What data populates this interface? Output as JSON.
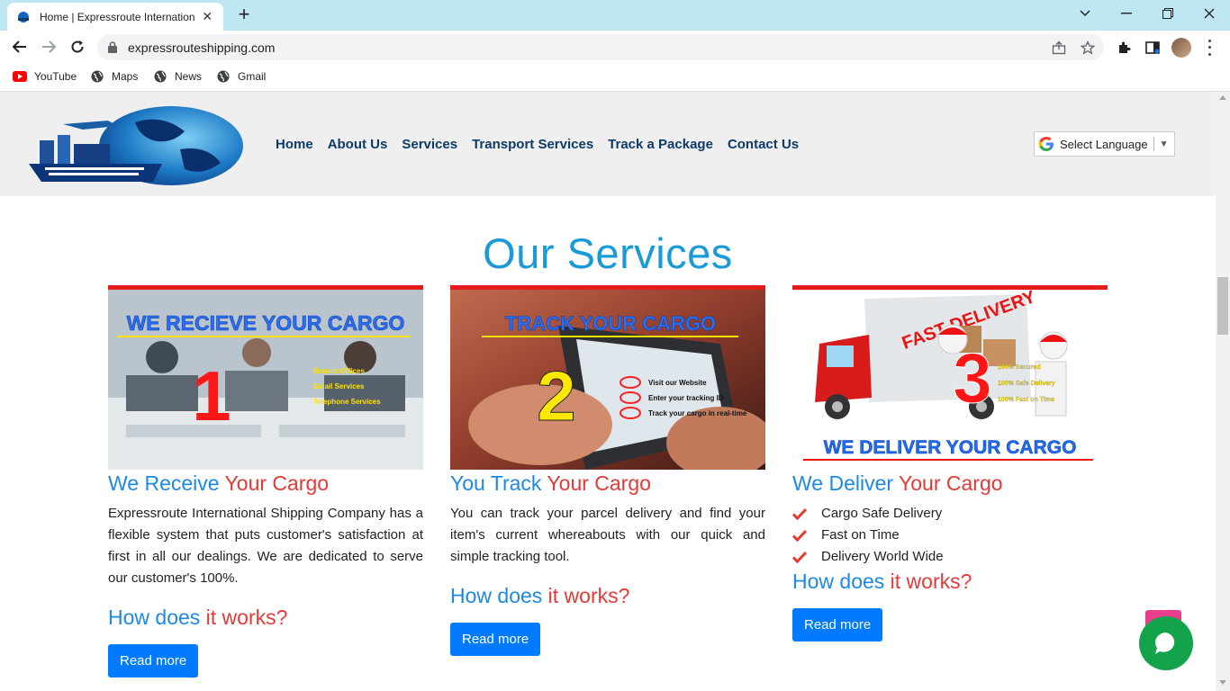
{
  "browser": {
    "tab_title": "Home | Expressroute International",
    "url": "expressrouteshipping.com",
    "bookmarks": [
      {
        "label": "YouTube",
        "icon": "youtube-icon"
      },
      {
        "label": "Maps",
        "icon": "globe-icon"
      },
      {
        "label": "News",
        "icon": "globe-icon"
      },
      {
        "label": "Gmail",
        "icon": "globe-icon"
      }
    ]
  },
  "site": {
    "nav": [
      "Home",
      "About Us",
      "Services",
      "Transport Services",
      "Track a Package",
      "Contact Us"
    ],
    "language_label": "Select Language",
    "section_title": "Our Services",
    "cards": [
      {
        "image_caption": "WE RECIEVE YOUR CARGO",
        "image_number": "1",
        "image_bullets": [
          "Branch Offices",
          "Email Services",
          "Telephone Services"
        ],
        "heading_plain": "We Receive ",
        "heading_accent": "Your Cargo",
        "body": "Expressroute International Shipping Company has a flexible system that puts customer's satisfaction at first in all our dealings. We are dedicated to serve our customer's 100%.",
        "how_plain": "How does ",
        "how_accent": "it works?",
        "button": "Read more"
      },
      {
        "image_caption": "TRACK YOUR CARGO",
        "image_number": "2",
        "image_bullets": [
          "Visit our Website",
          "Enter your tracking ID",
          "Track your cargo in real-time"
        ],
        "heading_plain": "You Track ",
        "heading_accent": "Your Cargo",
        "body": "You can track your parcel delivery and find your item's current whereabouts with our quick and simple tracking tool.",
        "how_plain": "How does ",
        "how_accent": "it works?",
        "button": "Read more"
      },
      {
        "image_caption": "WE DELIVER YOUR CARGO",
        "image_number": "3",
        "image_badge": "FAST DELIVERY",
        "image_bullets": [
          "100% Secured",
          "100% Safe Delivery",
          "100% Fast on Time"
        ],
        "heading_plain": "We Deliver ",
        "heading_accent": "Your Cargo",
        "checklist": [
          "Cargo Safe Delivery",
          "Fast on Time",
          "Delivery World Wide"
        ],
        "how_plain": "How does ",
        "how_accent": "it works?",
        "button": "Read more"
      }
    ]
  },
  "colors": {
    "nav_text": "#0d3b66",
    "title_blue": "#1a9bd7",
    "heading_blue": "#1e88e5",
    "accent_red": "#e53935",
    "button_blue": "#007bff",
    "chat_green": "#13a34a",
    "scrolltop_pink": "#e83e8c"
  }
}
